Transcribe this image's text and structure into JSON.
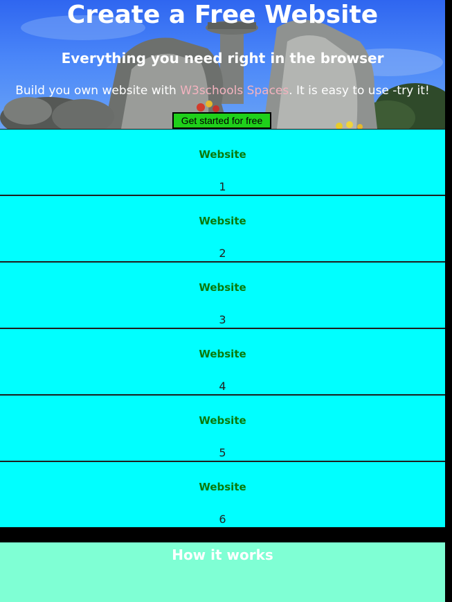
{
  "hero": {
    "title": "Create a Free Website",
    "subtitle": "Everything you need right in the browser",
    "text_before": "Build you own website with ",
    "link_text": "W3schools Spaces",
    "text_after": ". It is easy to use -try it!",
    "cta_label": "Get started for free"
  },
  "websites": [
    {
      "title": "Website",
      "number": "1"
    },
    {
      "title": "Website",
      "number": "2"
    },
    {
      "title": "Website",
      "number": "3"
    },
    {
      "title": "Website",
      "number": "4"
    },
    {
      "title": "Website",
      "number": "5"
    },
    {
      "title": "Website",
      "number": "6"
    }
  ],
  "how": {
    "title": "How it works"
  },
  "colors": {
    "card_background": "#00ffff",
    "card_title": "#0b7a0b",
    "cta_background": "#1fd01a",
    "how_background": "#7fffd4",
    "link": "#f4b3bf",
    "page_background": "#000000"
  }
}
